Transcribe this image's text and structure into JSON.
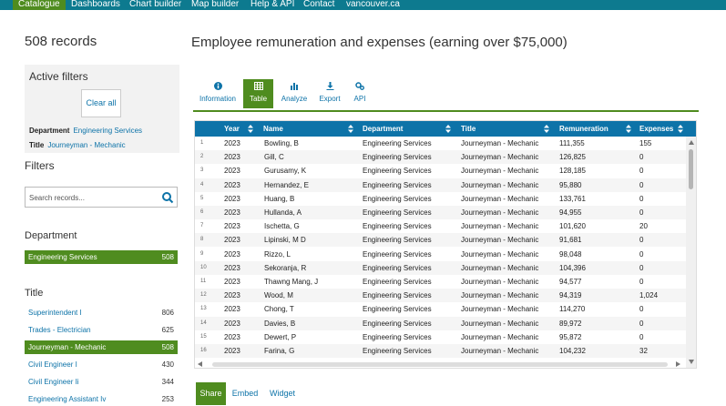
{
  "nav": {
    "items": [
      {
        "label": "Catalogue",
        "active": true
      },
      {
        "label": "Dashboards",
        "active": false
      },
      {
        "label": "Chart builder",
        "active": false
      },
      {
        "label": "Map builder",
        "active": false
      },
      {
        "label": "Help & API",
        "active": false
      },
      {
        "label": "Contact",
        "active": false
      },
      {
        "label": "vancouver.ca",
        "active": false
      }
    ]
  },
  "sidebar": {
    "records_count": "508 records",
    "active_filters": {
      "title": "Active filters",
      "clear_all": "Clear all",
      "filters": [
        {
          "key": "Department",
          "value": "Engineering Services"
        },
        {
          "key": "Title",
          "value": "Journeyman - Mechanic"
        }
      ]
    },
    "filters_title": "Filters",
    "search": {
      "placeholder": "Search records...",
      "icon": "search-icon"
    },
    "department": {
      "heading": "Department",
      "items": [
        {
          "label": "Engineering Services",
          "count": "508",
          "selected": true
        }
      ]
    },
    "title": {
      "heading": "Title",
      "items": [
        {
          "label": "Superintendent I",
          "count": "806",
          "selected": false
        },
        {
          "label": "Trades - Electrician",
          "count": "625",
          "selected": false
        },
        {
          "label": "Journeyman - Mechanic",
          "count": "508",
          "selected": true
        },
        {
          "label": "Civil Engineer I",
          "count": "430",
          "selected": false
        },
        {
          "label": "Civil Engineer Ii",
          "count": "344",
          "selected": false
        },
        {
          "label": "Engineering Assistant Iv",
          "count": "253",
          "selected": false
        }
      ]
    }
  },
  "main": {
    "title": "Employee remuneration and expenses (earning over $75,000)",
    "tabs": [
      {
        "label": "Information",
        "icon": "info-icon",
        "active": false
      },
      {
        "label": "Table",
        "icon": "table-icon",
        "active": true
      },
      {
        "label": "Analyze",
        "icon": "chart-icon",
        "active": false
      },
      {
        "label": "Export",
        "icon": "download-icon",
        "active": false
      },
      {
        "label": "API",
        "icon": "gears-icon",
        "active": false
      }
    ],
    "table": {
      "columns": [
        "Year",
        "Name",
        "Department",
        "Title",
        "Remuneration",
        "Expenses"
      ],
      "rows": [
        {
          "i": "1",
          "year": "2023",
          "name": "Bowling, B",
          "dept": "Engineering Services",
          "title": "Journeyman - Mechanic",
          "rem": "111,355",
          "exp": "155"
        },
        {
          "i": "2",
          "year": "2023",
          "name": "Gill, C",
          "dept": "Engineering Services",
          "title": "Journeyman - Mechanic",
          "rem": "126,825",
          "exp": "0"
        },
        {
          "i": "3",
          "year": "2023",
          "name": "Gurusamy, K",
          "dept": "Engineering Services",
          "title": "Journeyman - Mechanic",
          "rem": "128,185",
          "exp": "0"
        },
        {
          "i": "4",
          "year": "2023",
          "name": "Hernandez, E",
          "dept": "Engineering Services",
          "title": "Journeyman - Mechanic",
          "rem": "95,880",
          "exp": "0"
        },
        {
          "i": "5",
          "year": "2023",
          "name": "Huang, B",
          "dept": "Engineering Services",
          "title": "Journeyman - Mechanic",
          "rem": "133,761",
          "exp": "0"
        },
        {
          "i": "6",
          "year": "2023",
          "name": "Hullanda, A",
          "dept": "Engineering Services",
          "title": "Journeyman - Mechanic",
          "rem": "94,955",
          "exp": "0"
        },
        {
          "i": "7",
          "year": "2023",
          "name": "Ischetta, G",
          "dept": "Engineering Services",
          "title": "Journeyman - Mechanic",
          "rem": "101,620",
          "exp": "20"
        },
        {
          "i": "8",
          "year": "2023",
          "name": "Lipinski, M D",
          "dept": "Engineering Services",
          "title": "Journeyman - Mechanic",
          "rem": "91,681",
          "exp": "0"
        },
        {
          "i": "9",
          "year": "2023",
          "name": "Rizzo, L",
          "dept": "Engineering Services",
          "title": "Journeyman - Mechanic",
          "rem": "98,048",
          "exp": "0"
        },
        {
          "i": "10",
          "year": "2023",
          "name": "Sekoranja, R",
          "dept": "Engineering Services",
          "title": "Journeyman - Mechanic",
          "rem": "104,396",
          "exp": "0"
        },
        {
          "i": "11",
          "year": "2023",
          "name": "Thawng Mang, J",
          "dept": "Engineering Services",
          "title": "Journeyman - Mechanic",
          "rem": "94,577",
          "exp": "0"
        },
        {
          "i": "12",
          "year": "2023",
          "name": "Wood, M",
          "dept": "Engineering Services",
          "title": "Journeyman - Mechanic",
          "rem": "94,319",
          "exp": "1,024"
        },
        {
          "i": "13",
          "year": "2023",
          "name": "Chong, T",
          "dept": "Engineering Services",
          "title": "Journeyman - Mechanic",
          "rem": "114,270",
          "exp": "0"
        },
        {
          "i": "14",
          "year": "2023",
          "name": "Davies, B",
          "dept": "Engineering Services",
          "title": "Journeyman - Mechanic",
          "rem": "89,972",
          "exp": "0"
        },
        {
          "i": "15",
          "year": "2023",
          "name": "Dewert, P",
          "dept": "Engineering Services",
          "title": "Journeyman - Mechanic",
          "rem": "95,872",
          "exp": "0"
        },
        {
          "i": "16",
          "year": "2023",
          "name": "Farina, G",
          "dept": "Engineering Services",
          "title": "Journeyman - Mechanic",
          "rem": "104,232",
          "exp": "32"
        }
      ]
    },
    "bottom_tabs": [
      {
        "label": "Share",
        "active": true
      },
      {
        "label": "Embed",
        "active": false
      },
      {
        "label": "Widget",
        "active": false
      }
    ]
  },
  "colors": {
    "brand_teal": "#0d7a8f",
    "header_blue": "#0d73a8",
    "active_green": "#4f8c1f",
    "link_blue": "#0d73a8"
  }
}
